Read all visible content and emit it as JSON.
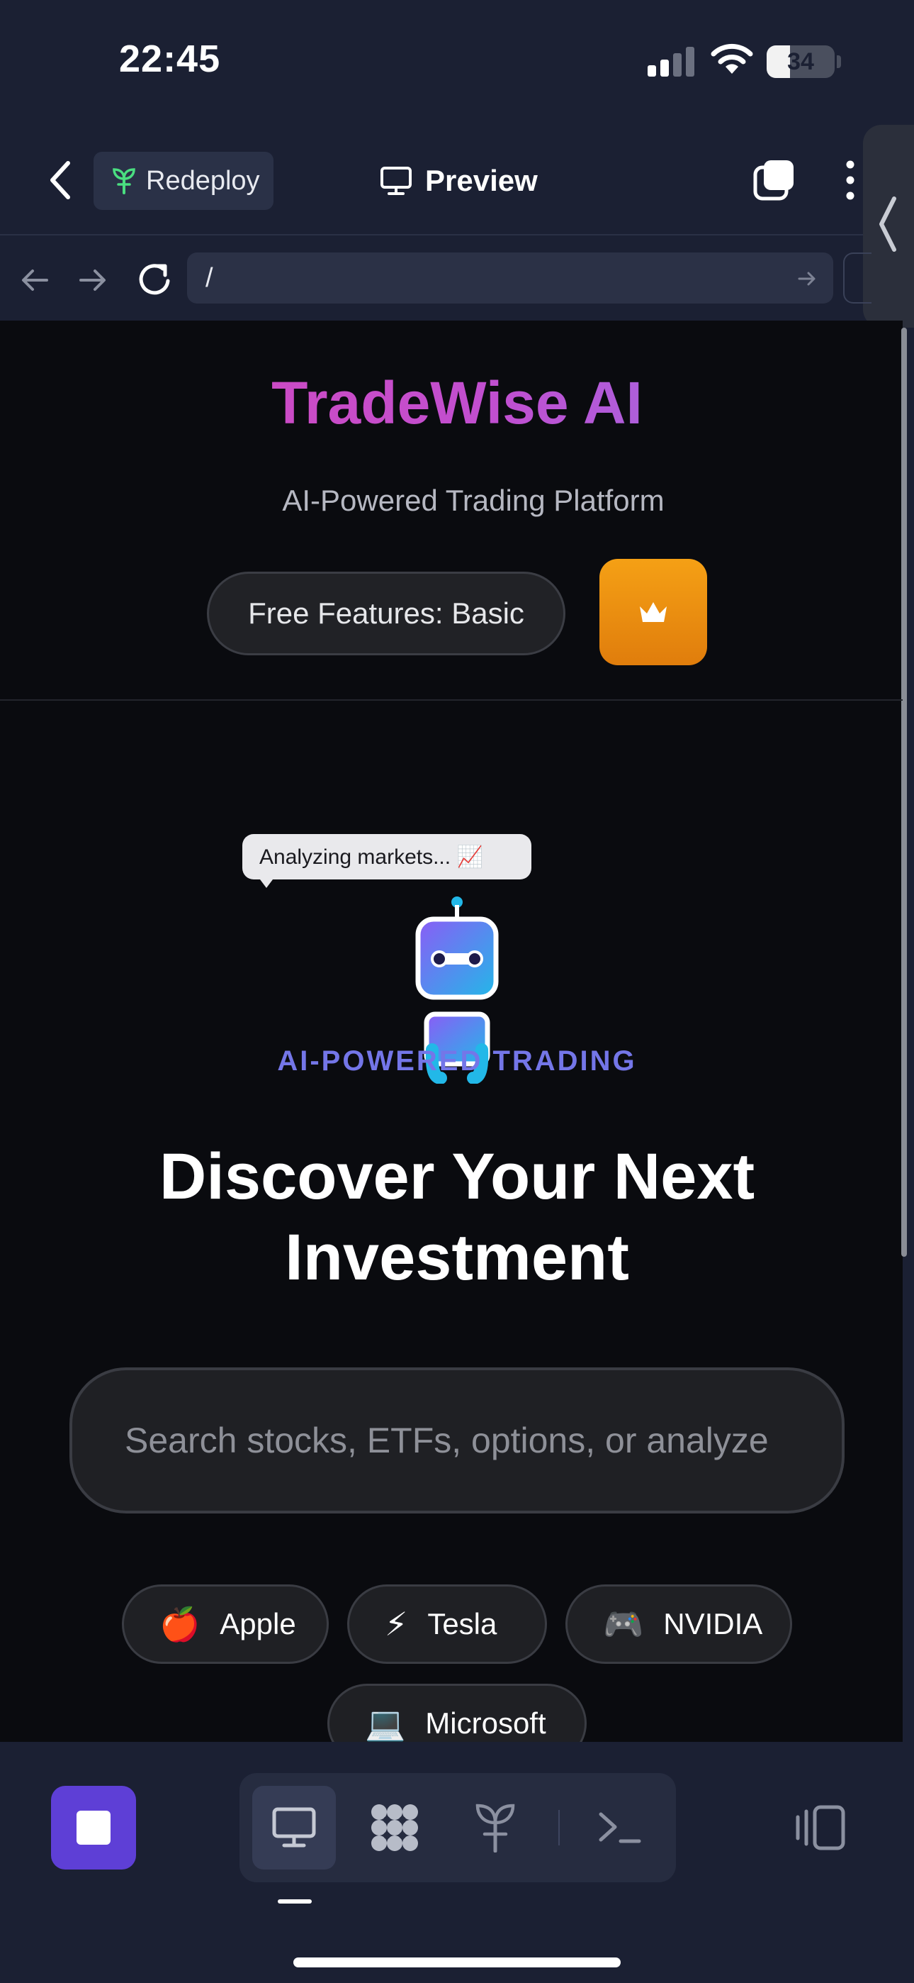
{
  "status_bar": {
    "time": "22:45",
    "battery_level": "34",
    "battery_fraction": 0.34
  },
  "toolbar": {
    "redeploy_label": "Redeploy",
    "preview_label": "Preview",
    "icons": [
      "chevron-left-icon",
      "sprout-icon",
      "monitor-icon",
      "tabs-icon",
      "more-vertical-icon",
      "chevron-left-icon"
    ]
  },
  "url_bar": {
    "value": "/",
    "icons": [
      "arrow-left-icon",
      "arrow-right-icon",
      "reload-icon",
      "arrow-right-icon"
    ]
  },
  "page": {
    "brand_title": "TradeWise AI",
    "brand_subtitle": "AI-Powered Trading Platform",
    "free_badge": "Free Features: Basic",
    "crown_icon": "crown-icon",
    "speech_bubble": "Analyzing markets... 📈",
    "tagline": "AI-POWERED TRADING",
    "headline_line1": "Discover Your Next",
    "headline_line2": "Investment",
    "search_placeholder": "Search stocks, ETFs, options, or analyze",
    "quick_picks": [
      {
        "emoji": "🍎",
        "label": "Apple"
      },
      {
        "emoji": "⚡",
        "label": "Tesla"
      },
      {
        "emoji": "🎮",
        "label": "NVIDIA"
      },
      {
        "emoji": "💻",
        "label": "Microsoft"
      }
    ]
  },
  "bottom_bar": {
    "tabs": [
      "monitor-icon",
      "apps-icon",
      "sprout-icon",
      "terminal-icon"
    ],
    "active_tab": "monitor-icon"
  },
  "colors": {
    "accent": "#5e3fd6",
    "brand_gradient_start": "#d946b8",
    "brand_gradient_end": "#8b7cf0",
    "crown_button": "#f5a015",
    "tagline": "#7476e8"
  }
}
